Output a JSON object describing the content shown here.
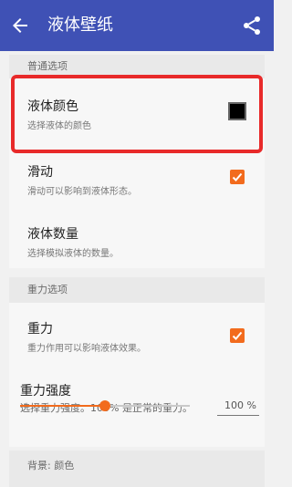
{
  "appbar": {
    "title": "液体壁纸",
    "back_icon": "arrow-back-icon",
    "share_icon": "share-icon"
  },
  "sections": {
    "general": "普通选项",
    "gravity": "重力选项",
    "background": "背景: 颜色"
  },
  "items": {
    "liquid_color": {
      "title": "液体颜色",
      "subtitle": "选择液体的颜色",
      "color": "#000000"
    },
    "slide": {
      "title": "滑动",
      "subtitle": "滑动可以影响到液体形态。",
      "checked": true
    },
    "liquid_count": {
      "title": "液体数量",
      "subtitle": "选择模拟液体的数量。"
    },
    "gravity": {
      "title": "重力",
      "subtitle": "重力作用可以影响液体效果。",
      "checked": true
    },
    "gravity_strength": {
      "title": "重力强度",
      "subtitle": "选择重力强度。100% 是正常的重力。",
      "value_label": "100 %",
      "slider_fraction": 0.5
    }
  },
  "colors": {
    "appbar": "#3f51b5",
    "accent": "#f26b1d",
    "highlight": "#e82a2a"
  }
}
